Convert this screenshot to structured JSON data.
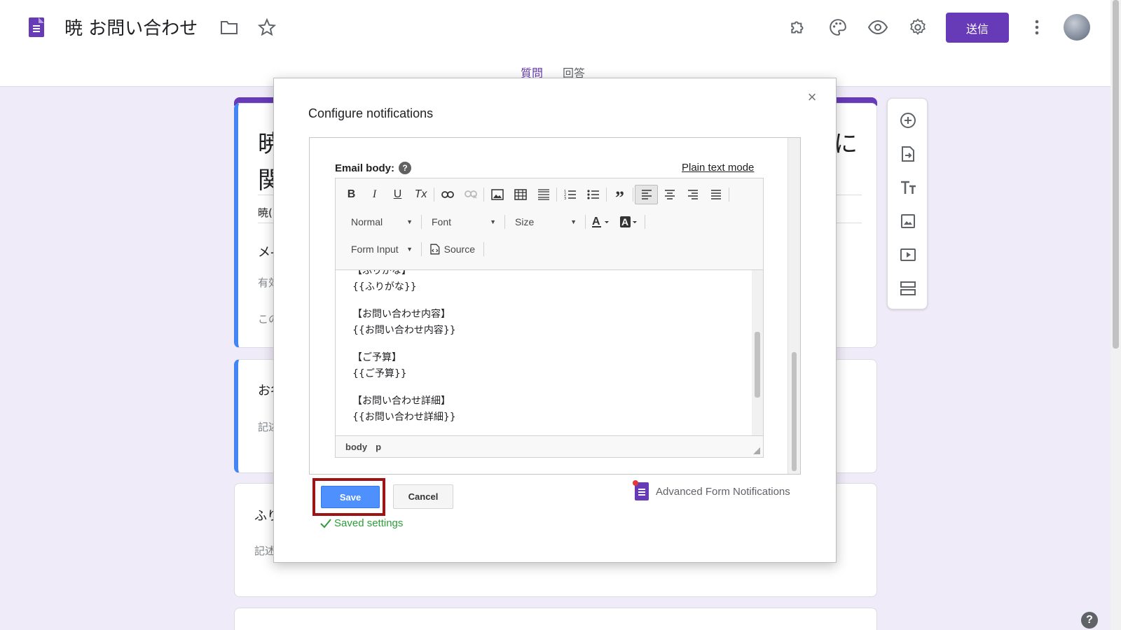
{
  "header": {
    "doc_title": "暁 お問い合わせ",
    "send_label": "送信",
    "tabs": [
      {
        "label": "質問",
        "active": true
      },
      {
        "label": "回答",
        "active": false
      }
    ]
  },
  "background": {
    "title_fragment_1": "暁",
    "title_fragment_2": "関",
    "title_tail": "に",
    "desc_fragment": "暁(",
    "q1_fragment": "メ-",
    "q1_sub_1": "有効",
    "q1_sub_2": "この",
    "q2_fragment": "お名",
    "q2_sub": "記述",
    "q3_fragment": "ふり",
    "q3_sub": "記述"
  },
  "dialog": {
    "title": "Configure notifications",
    "close_label": "×",
    "email_body_label": "Email body:",
    "help_label": "?",
    "plain_text_link": "Plain text mode",
    "toolbar": {
      "bold": "B",
      "italic": "I",
      "underline": "U",
      "clear": "Tx",
      "format_label": "Normal",
      "font_label": "Font",
      "size_label": "Size",
      "form_input_label": "Form Input",
      "source_label": "Source"
    },
    "body_lines": [
      "【ふりがな】",
      "{{ふりがな}}",
      "【お問い合わせ内容】",
      "{{お問い合わせ内容}}",
      "【ご予算】",
      "{{ご予算}}",
      "【お問い合わせ詳細】",
      "{{お問い合わせ詳細}}"
    ],
    "status_path": [
      "body",
      "p"
    ],
    "save_label": "Save",
    "cancel_label": "Cancel",
    "saved_message": "Saved settings",
    "addon_name": "Advanced Form Notifications"
  },
  "colors": {
    "brand": "#673ab7",
    "save_button": "#4d90fe",
    "highlight_border": "#9c1414",
    "success": "#2e9c3b"
  }
}
